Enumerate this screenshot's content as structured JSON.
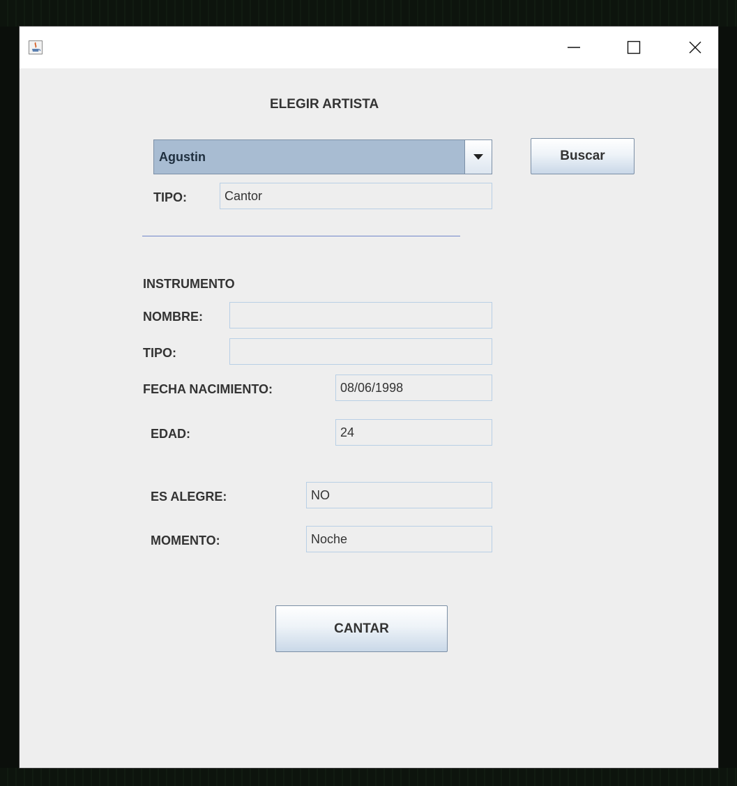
{
  "window": {
    "title": ""
  },
  "header": {
    "title": "ELEGIR ARTISTA"
  },
  "artist_select": {
    "selected": "Agustin"
  },
  "buttons": {
    "search": "Buscar",
    "sing": "CANTAR"
  },
  "labels": {
    "tipo_artist": "TIPO:",
    "instrumento": "INSTRUMENTO",
    "nombre": "NOMBRE:",
    "tipo_instrument": "TIPO:",
    "fecha_nacimiento": "FECHA NACIMIENTO:",
    "edad": "EDAD:",
    "es_alegre": "ES ALEGRE:",
    "momento": "MOMENTO:"
  },
  "values": {
    "tipo_artist": "Cantor",
    "nombre": "",
    "tipo_instrument": "",
    "fecha_nacimiento": "08/06/1998",
    "edad": "24",
    "es_alegre": "NO",
    "momento": "Noche"
  },
  "icons": {
    "app": "java-icon",
    "minimize": "minimize-icon",
    "maximize": "maximize-icon",
    "close": "close-icon",
    "dropdown": "dropdown-arrow-icon"
  },
  "colors": {
    "window_bg": "#eeeeee",
    "titlebar_bg": "#ffffff",
    "combo_selected_bg": "#a8bcd2",
    "field_border": "#b8cfe5",
    "separator": "#6f86c9"
  }
}
